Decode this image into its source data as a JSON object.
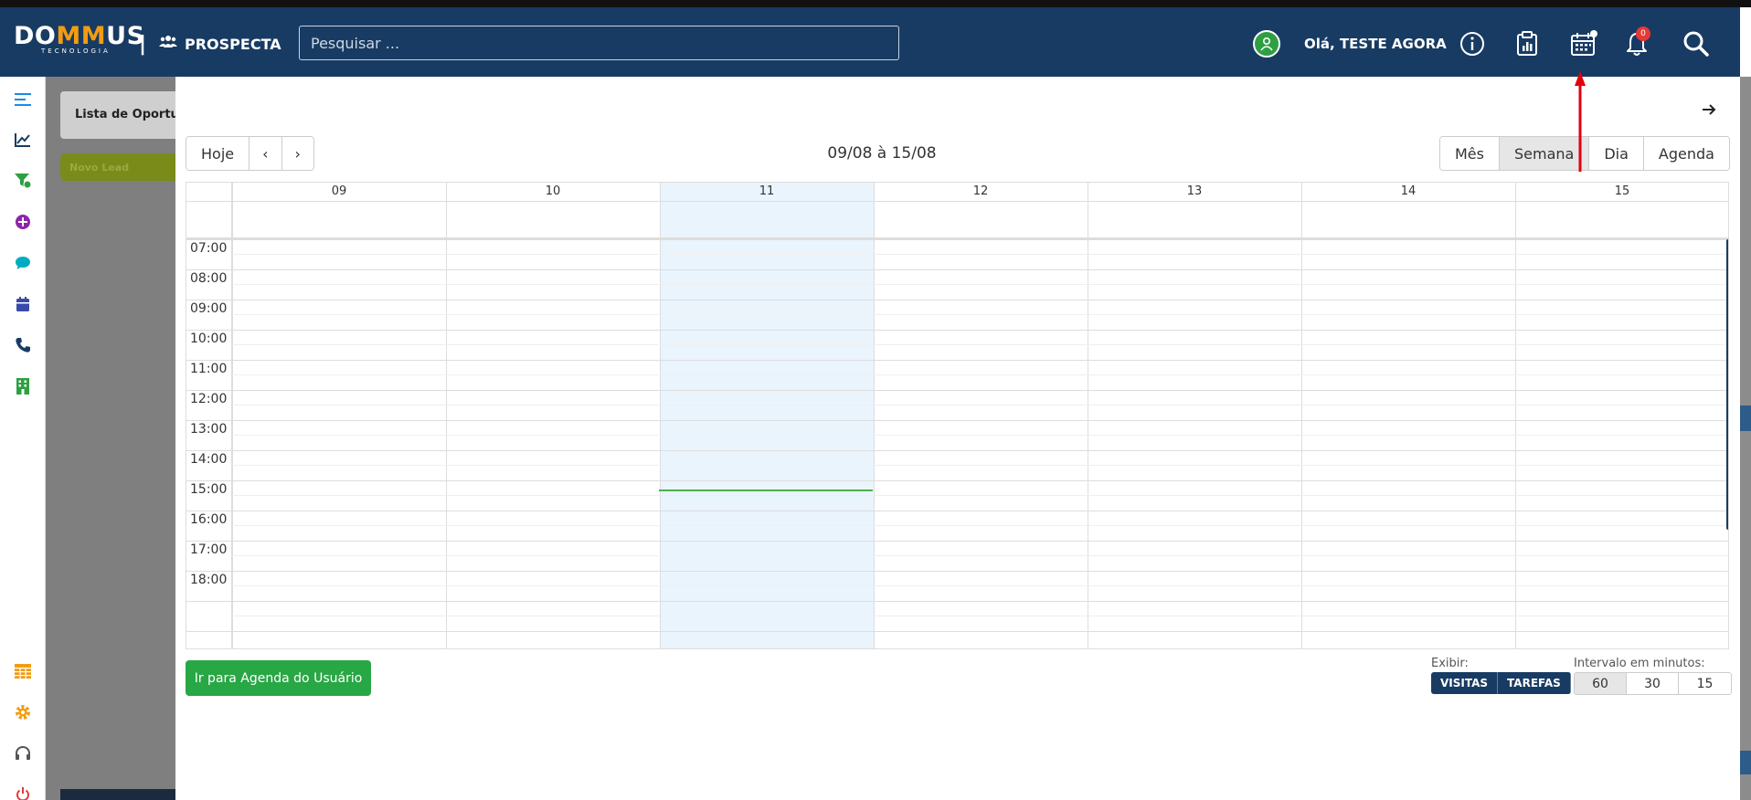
{
  "header": {
    "brand": "DOMMUS",
    "brand_tagline": "TECNOLOGIA",
    "module": "PROSPECTA",
    "search_placeholder": "Pesquisar ...",
    "greeting": "Olá, TESTE AGORA",
    "notification_count": "0"
  },
  "background_page": {
    "card_title": "Lista de Oportu",
    "pill_label": "Novo Lead"
  },
  "calendar": {
    "toolbar": {
      "today": "Hoje",
      "prev": "‹",
      "next": "›",
      "range": "09/08 à 15/08",
      "views": [
        "Mês",
        "Semana",
        "Dia",
        "Agenda"
      ],
      "active_view": "Semana"
    },
    "days": [
      "09",
      "10",
      "11",
      "12",
      "13",
      "14",
      "15"
    ],
    "today_index": 2,
    "hours": [
      "07:00",
      "08:00",
      "09:00",
      "10:00",
      "11:00",
      "12:00",
      "13:00",
      "14:00",
      "15:00",
      "16:00",
      "17:00",
      "18:00"
    ]
  },
  "footer": {
    "go_to_agenda": "Ir para Agenda do Usuário",
    "display_label": "Exibir:",
    "display_options": [
      "VISITAS",
      "TAREFAS"
    ],
    "interval_label": "Intervalo em minutos:",
    "interval_options": [
      "60",
      "30",
      "15"
    ],
    "active_interval": "60"
  },
  "colors": {
    "header_bg": "#183b63",
    "today_bg": "#eaf4fd",
    "now_line": "#4caf50",
    "primary_green": "#28a745",
    "accent_orange": "#f39c12",
    "annotation_red": "#e3000f"
  },
  "icons": {
    "sidebar": [
      "menu-icon",
      "chart-line-icon",
      "funnel-icon",
      "plus-circle-icon",
      "chat-icon",
      "calendar-icon",
      "phone-icon",
      "building-icon",
      "table-icon",
      "gear-icon",
      "headset-icon",
      "power-icon"
    ],
    "header": [
      "users-icon",
      "user-avatar-icon",
      "info-icon",
      "clipboard-chart-icon",
      "calendar-icon",
      "bell-icon",
      "search-icon"
    ]
  }
}
